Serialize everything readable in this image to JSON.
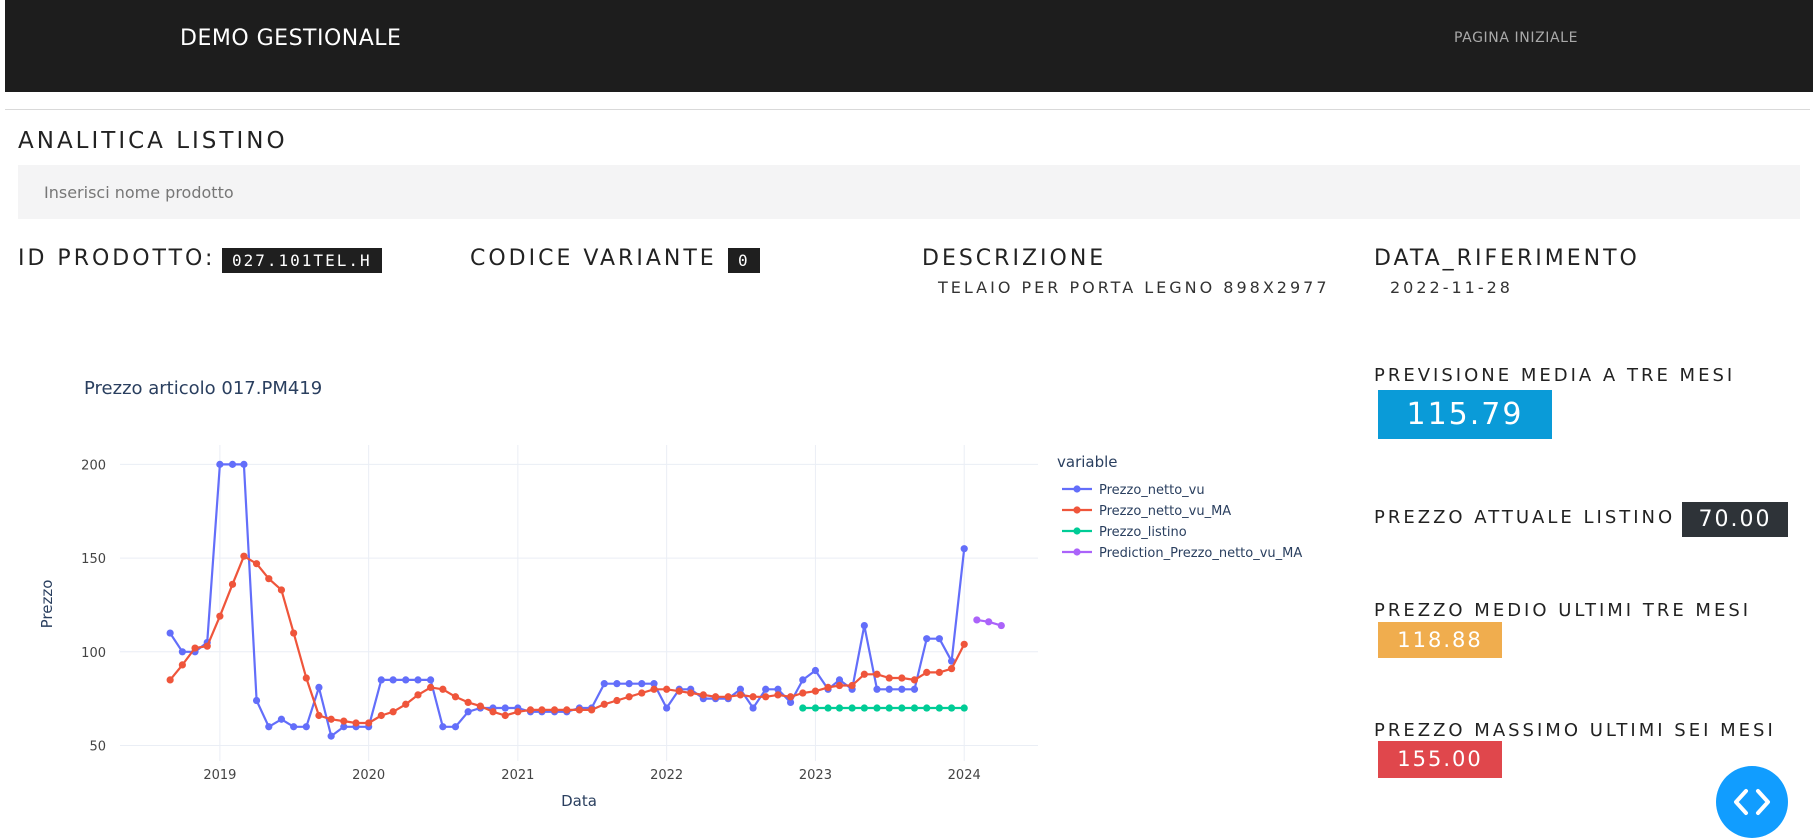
{
  "navbar": {
    "brand": "DEMO GESTIONALE",
    "link": "PAGINA INIZIALE"
  },
  "page": {
    "title": "ANALITICA LISTINO",
    "search_placeholder": "Inserisci nome prodotto"
  },
  "product": {
    "id_label": "ID PRODOTTO:",
    "id_value": "027.101TEL.H",
    "variant_label": "CODICE VARIANTE",
    "variant_value": "0",
    "description_label": "DESCRIZIONE",
    "description_value": "TELAIO PER PORTA LEGNO 898X2977",
    "date_label": "DATA_RIFERIMENTO",
    "date_value": "2022-11-28"
  },
  "stats": {
    "forecast_label": "PREVISIONE MEDIA A TRE MESI",
    "forecast_value": "115.79",
    "forecast_color": "#0a9bd8",
    "current_label": "PREZZO ATTUALE LISTINO",
    "current_value": "70.00",
    "current_color": "#2e3338",
    "avg3_label": "PREZZO MEDIO ULTIMI TRE MESI",
    "avg3_value": "118.88",
    "avg3_color": "#f0ad4e",
    "max6_label": "PREZZO MASSIMO ULTIMI SEI MESI",
    "max6_value": "155.00",
    "max6_color": "#e0474c"
  },
  "code_toggle_icon": "code-brackets-icon",
  "chart_data": {
    "type": "line",
    "title": "Prezzo articolo 017.PM419",
    "xlabel": "Data",
    "ylabel": "Prezzo",
    "legend_title": "variable",
    "legend_position": "right",
    "grid": true,
    "xlim": [
      "2018-05-01",
      "2024-06-30"
    ],
    "ylim": [
      46,
      205
    ],
    "x_ticks": [
      "2019",
      "2020",
      "2021",
      "2022",
      "2023",
      "2024"
    ],
    "y_ticks": [
      50,
      100,
      150,
      200
    ],
    "series": [
      {
        "name": "Prezzo_netto_vu",
        "color": "#636efa",
        "x": [
          "2018-09-01",
          "2018-10-01",
          "2018-11-01",
          "2018-12-01",
          "2019-01-01",
          "2019-02-01",
          "2019-03-01",
          "2019-04-01",
          "2019-05-01",
          "2019-06-01",
          "2019-07-01",
          "2019-08-01",
          "2019-09-01",
          "2019-10-01",
          "2019-11-01",
          "2019-12-01",
          "2020-01-01",
          "2020-02-01",
          "2020-03-01",
          "2020-04-01",
          "2020-05-01",
          "2020-06-01",
          "2020-07-01",
          "2020-08-01",
          "2020-09-01",
          "2020-10-01",
          "2020-11-01",
          "2020-12-01",
          "2021-01-01",
          "2021-02-01",
          "2021-03-01",
          "2021-04-01",
          "2021-05-01",
          "2021-06-01",
          "2021-07-01",
          "2021-08-01",
          "2021-09-01",
          "2021-10-01",
          "2021-11-01",
          "2021-12-01",
          "2022-01-01",
          "2022-02-01",
          "2022-03-01",
          "2022-04-01",
          "2022-05-01",
          "2022-06-01",
          "2022-07-01",
          "2022-08-01",
          "2022-09-01",
          "2022-10-01",
          "2022-11-01",
          "2022-12-01",
          "2023-01-01",
          "2023-02-01",
          "2023-03-01",
          "2023-04-01",
          "2023-05-01",
          "2023-06-01",
          "2023-07-01",
          "2023-08-01",
          "2023-09-01",
          "2023-10-01",
          "2023-11-01",
          "2023-12-01",
          "2024-01-01"
        ],
        "values": [
          110,
          100,
          100,
          105,
          200,
          200,
          200,
          74,
          60,
          64,
          60,
          60,
          81,
          55,
          60,
          60,
          60,
          85,
          85,
          85,
          85,
          85,
          60,
          60,
          68,
          70,
          70,
          70,
          70,
          68,
          68,
          68,
          68,
          70,
          70,
          83,
          83,
          83,
          83,
          83,
          70,
          80,
          80,
          75,
          75,
          75,
          80,
          70,
          80,
          80,
          73,
          85,
          90,
          80,
          85,
          80,
          114,
          80,
          80,
          80,
          80,
          107,
          107,
          95,
          155
        ]
      },
      {
        "name": "Prezzo_netto_vu_MA",
        "color": "#ef553b",
        "x": [
          "2018-09-01",
          "2018-10-01",
          "2018-11-01",
          "2018-12-01",
          "2019-01-01",
          "2019-02-01",
          "2019-03-01",
          "2019-04-01",
          "2019-05-01",
          "2019-06-01",
          "2019-07-01",
          "2019-08-01",
          "2019-09-01",
          "2019-10-01",
          "2019-11-01",
          "2019-12-01",
          "2020-01-01",
          "2020-02-01",
          "2020-03-01",
          "2020-04-01",
          "2020-05-01",
          "2020-06-01",
          "2020-07-01",
          "2020-08-01",
          "2020-09-01",
          "2020-10-01",
          "2020-11-01",
          "2020-12-01",
          "2021-01-01",
          "2021-02-01",
          "2021-03-01",
          "2021-04-01",
          "2021-05-01",
          "2021-06-01",
          "2021-07-01",
          "2021-08-01",
          "2021-09-01",
          "2021-10-01",
          "2021-11-01",
          "2021-12-01",
          "2022-01-01",
          "2022-02-01",
          "2022-03-01",
          "2022-04-01",
          "2022-05-01",
          "2022-06-01",
          "2022-07-01",
          "2022-08-01",
          "2022-09-01",
          "2022-10-01",
          "2022-11-01",
          "2022-12-01",
          "2023-01-01",
          "2023-02-01",
          "2023-03-01",
          "2023-04-01",
          "2023-05-01",
          "2023-06-01",
          "2023-07-01",
          "2023-08-01",
          "2023-09-01",
          "2023-10-01",
          "2023-11-01",
          "2023-12-01",
          "2024-01-01"
        ],
        "values": [
          85,
          93,
          102,
          103,
          119,
          136,
          151,
          147,
          139,
          133,
          110,
          86,
          66,
          64,
          63,
          62,
          62,
          66,
          68,
          72,
          77,
          81,
          80,
          76,
          73,
          71,
          68,
          66,
          68,
          69,
          69,
          69,
          69,
          69,
          69,
          72,
          74,
          76,
          78,
          80,
          80,
          79,
          78,
          77,
          76,
          76,
          77,
          76,
          76,
          77,
          76,
          78,
          79,
          81,
          82,
          82,
          88,
          88,
          86,
          86,
          85,
          89,
          89,
          91,
          104
        ]
      },
      {
        "name": "Prezzo_listino",
        "color": "#00cc96",
        "x": [
          "2022-12-01",
          "2023-01-01",
          "2023-02-01",
          "2023-03-01",
          "2023-04-01",
          "2023-05-01",
          "2023-06-01",
          "2023-07-01",
          "2023-08-01",
          "2023-09-01",
          "2023-10-01",
          "2023-11-01",
          "2023-12-01",
          "2024-01-01"
        ],
        "values": [
          70,
          70,
          70,
          70,
          70,
          70,
          70,
          70,
          70,
          70,
          70,
          70,
          70,
          70
        ]
      },
      {
        "name": "Prediction_Prezzo_netto_vu_MA",
        "color": "#ab63fa",
        "x": [
          "2024-02-01",
          "2024-03-01",
          "2024-04-01"
        ],
        "values": [
          117,
          116,
          114
        ]
      }
    ]
  }
}
